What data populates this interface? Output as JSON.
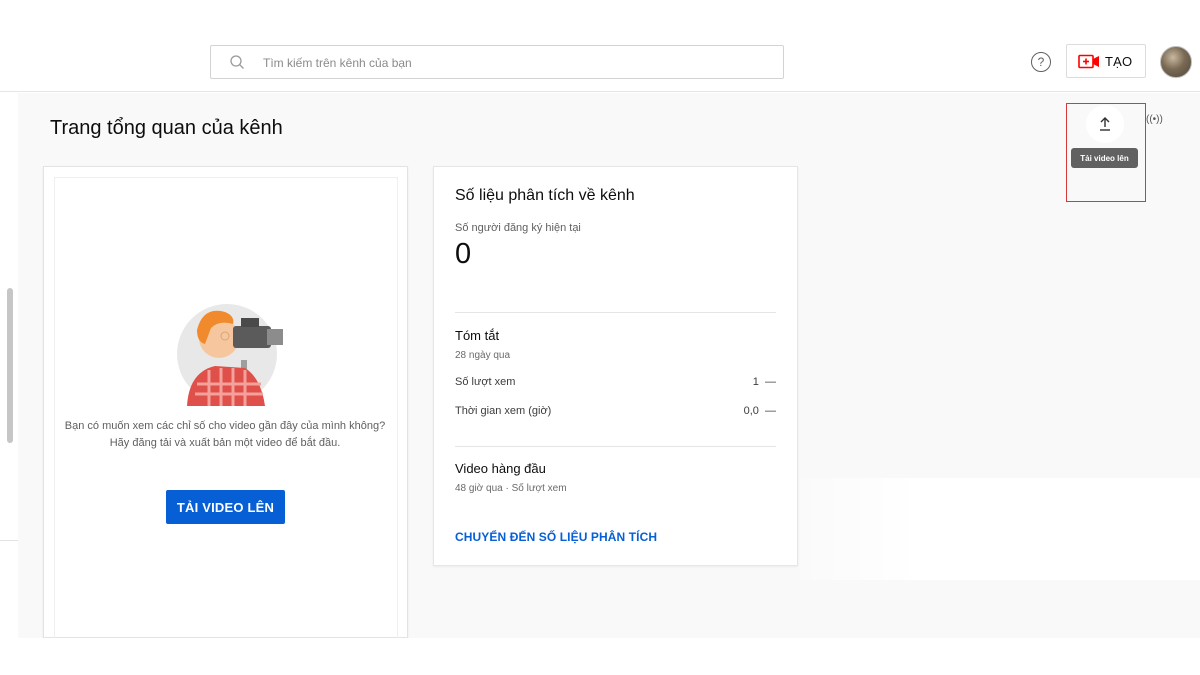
{
  "header": {
    "search_placeholder": "Tìm kiếm trên kênh của bạn",
    "help_icon": "?",
    "create_label": "TẠO"
  },
  "page": {
    "title": "Trang tổng quan của kênh"
  },
  "empty_state": {
    "line1": "Bạn có muốn xem các chỉ số cho video gần đây của mình không?",
    "line2": "Hãy đăng tải và xuất bản một video để bắt đầu.",
    "button": "TẢI VIDEO LÊN"
  },
  "analytics": {
    "title": "Số liệu phân tích về kênh",
    "subscribers_label": "Số người đăng ký hiện tại",
    "subscribers_value": "0",
    "summary_title": "Tóm tắt",
    "summary_period": "28 ngày qua",
    "metrics": [
      {
        "label": "Số lượt xem",
        "value": "1",
        "trend": "—"
      },
      {
        "label": "Thời gian xem (giờ)",
        "value": "0,0",
        "trend": "—"
      }
    ],
    "top_videos_title": "Video hàng đầu",
    "top_videos_sub": "48 giờ qua · Số lượt xem",
    "link": "CHUYỂN ĐẾN SỐ LIỆU PHÂN TÍCH"
  },
  "floating": {
    "tooltip": "Tải video lên",
    "live_icon": "((•))"
  },
  "colors": {
    "accent_blue": "#065fd4",
    "brand_red": "#ff0000",
    "highlight_red": "#d43a3a"
  },
  "icons": [
    "search-icon",
    "help-icon",
    "create-camera-icon",
    "upload-icon",
    "live-icon"
  ]
}
